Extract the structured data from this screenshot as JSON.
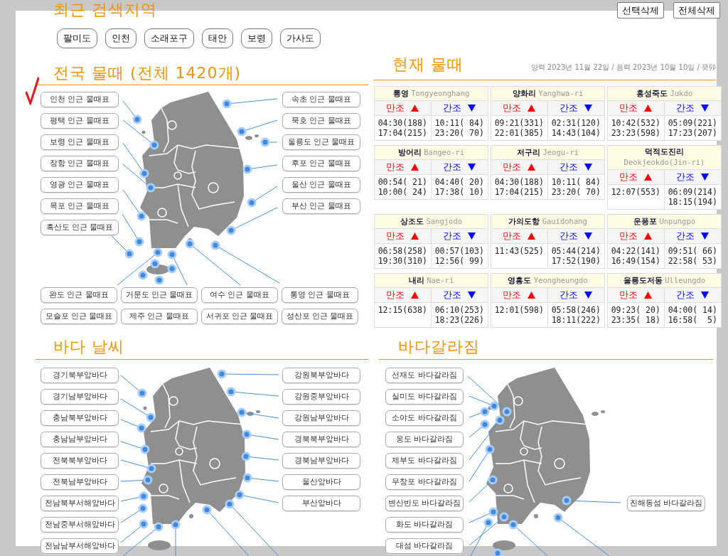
{
  "recent_searches": {
    "title": "최근 검색지역",
    "buttons": [
      "선택삭제",
      "전체삭제"
    ],
    "chips": [
      "팔미도",
      "인천",
      "소래포구",
      "태안",
      "보령",
      "가사도"
    ]
  },
  "tide_map": {
    "title": "전국 물때 (전체 1420개)",
    "left": [
      {
        "label": "인천 인근 물때표",
        "marked": true
      },
      {
        "label": "평택 인근 물때표",
        "marked": false
      },
      {
        "label": "보령 인근 물때표",
        "marked": false
      },
      {
        "label": "장항 인근 물때표",
        "marked": false
      },
      {
        "label": "영광 인근 물때표",
        "marked": false
      },
      {
        "label": "목포 인근 물때표",
        "marked": false
      },
      {
        "label": "흑산도 인근 물때표",
        "marked": false
      }
    ],
    "right": [
      {
        "label": "속초 인근 물때표",
        "marked": false
      },
      {
        "label": "묵호 인근 물때표",
        "marked": false
      },
      {
        "label": "울릉도 인근 물때표",
        "marked": false
      },
      {
        "label": "후포 인근 물때표",
        "marked": false
      },
      {
        "label": "울산 인근 물때표",
        "marked": false
      },
      {
        "label": "부산 인근 물때표",
        "marked": false
      }
    ],
    "bottom": [
      {
        "label": "완도 인근 물때표",
        "marked": false
      },
      {
        "label": "거문도 인근 물때표",
        "marked": false
      },
      {
        "label": "여수 인근 물때표",
        "marked": false
      },
      {
        "label": "통영 인근 물때표",
        "marked": false
      },
      {
        "label": "모슬포 인근 물때표",
        "marked": false
      },
      {
        "label": "제주 인근 물때표",
        "marked": false
      },
      {
        "label": "서귀포 인근 물때표",
        "marked": false
      },
      {
        "label": "성산포 인근 물때표",
        "marked": false
      }
    ]
  },
  "current_tide": {
    "title": "현재 물때",
    "date": "양력 2023년 11월 22일 / 음력 2023년 10월 10일 / 癸卯",
    "cards": [
      {
        "name": "통영",
        "roman": "Tongyeonghang",
        "high_label": "만조",
        "low_label": "간조",
        "high": [
          "04:30(188)",
          "17:04(215)"
        ],
        "low": [
          "10:11( 84)",
          "23:20( 70)"
        ]
      },
      {
        "name": "양화리",
        "roman": "Yanghwa-ri",
        "high_label": "만조",
        "low_label": "간조",
        "high": [
          "09:21(331)",
          "22:01(385)"
        ],
        "low": [
          "02:31(120)",
          "14:43(104)"
        ]
      },
      {
        "name": "홍성죽도",
        "roman": "Jukdo",
        "high_label": "만조",
        "low_label": "간조",
        "high": [
          "10:42(532)",
          "23:23(598)"
        ],
        "low": [
          "05:09(221)",
          "17:23(207)"
        ]
      },
      {
        "name": "방어리",
        "roman": "Bangeo-ri",
        "high_label": "만조",
        "low_label": "간조",
        "high": [
          "00:54( 21)",
          "10:00( 24)"
        ],
        "low": [
          "04:40( 20)",
          "17:38( 10)"
        ]
      },
      {
        "name": "저구리",
        "roman": "Jeogu-ri",
        "high_label": "만조",
        "low_label": "간조",
        "high": [
          "04:30(188)",
          "17:04(215)"
        ],
        "low": [
          "10:11( 84)",
          "23:20( 70)"
        ]
      },
      {
        "name": "덕적도진리",
        "roman": "Deokjeokdo(Jin-ri)",
        "high_label": "만조",
        "low_label": "간조",
        "high": [
          "12:07(553)"
        ],
        "low": [
          "06:09(214)",
          "18:15(194)"
        ]
      },
      {
        "name": "상조도",
        "roman": "Sangjodo",
        "high_label": "만조",
        "low_label": "간조",
        "high": [
          "06:58(258)",
          "19:30(310)"
        ],
        "low": [
          "00:57(103)",
          "12:56( 99)"
        ]
      },
      {
        "name": "가의도항",
        "roman": "Gauidohang",
        "high_label": "만조",
        "low_label": "간조",
        "high": [
          "11:43(525)"
        ],
        "low": [
          "05:44(214)",
          "17:52(190)"
        ]
      },
      {
        "name": "운풍포",
        "roman": "Unpungpo",
        "high_label": "만조",
        "low_label": "간조",
        "high": [
          "04:22(141)",
          "16:49(154)"
        ],
        "low": [
          "09:51( 66)",
          "22:58( 53)"
        ]
      },
      {
        "name": "내리",
        "roman": "Nae-ri",
        "high_label": "만조",
        "low_label": "간조",
        "high": [
          "12:15(638)"
        ],
        "low": [
          "06:10(253)",
          "18:23(226)"
        ]
      },
      {
        "name": "영흥도",
        "roman": "Yeongheungdo",
        "high_label": "만조",
        "low_label": "간조",
        "high": [
          "12:01(598)"
        ],
        "low": [
          "05:58(246)",
          "18:11(222)"
        ]
      },
      {
        "name": "울릉도저동",
        "roman": "Ulleungdo",
        "high_label": "만조",
        "low_label": "간조",
        "high": [
          "09:23( 20)",
          "23:35( 18)"
        ],
        "low": [
          "04:00( 14)",
          "16:58(  5)"
        ]
      }
    ]
  },
  "sea_weather": {
    "title": "바다 날씨",
    "left": [
      "경기북부앞바다",
      "경기남부앞바다",
      "충남북부앞바다",
      "충남남부앞바다",
      "전북북부앞바다",
      "전북남부앞바다",
      "전남북부서해앞바다",
      "전남중부서해앞바다",
      "전남남부서해앞바다"
    ],
    "right": [
      "강원북부앞바다",
      "강원중부앞바다",
      "강원남부앞바다",
      "경북북부앞바다",
      "경북남부앞바다",
      "울산앞바다",
      "부산앞바다"
    ]
  },
  "sea_parting": {
    "title": "바다갈라짐",
    "left": [
      "선재도 바다갈라짐",
      "실미도 바다갈라짐",
      "소야도 바다갈라짐",
      "웅도 바다갈라짐",
      "제부도 바다갈라짐",
      "무창포 바다갈라짐",
      "변산반도 바다갈라짐",
      "화도 바다갈라짐",
      "대섬 바다갈라짐"
    ],
    "right": [
      "진해동섬 바다갈라짐"
    ]
  }
}
